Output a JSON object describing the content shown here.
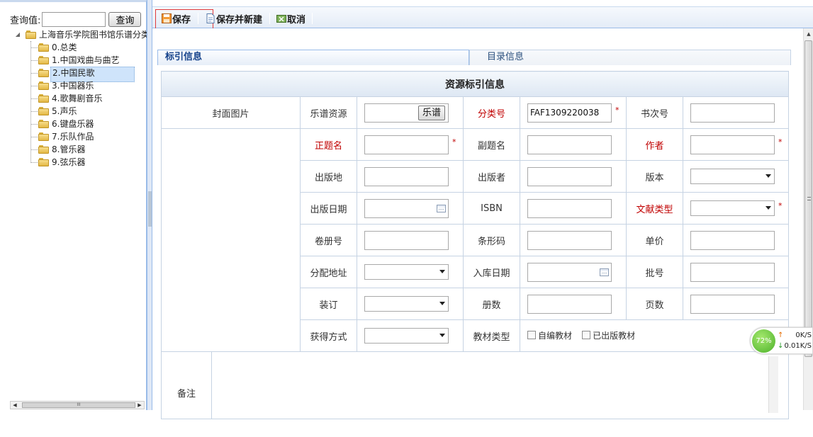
{
  "search": {
    "label": "查询值:",
    "value": "",
    "button": "查询"
  },
  "tree": {
    "root": "上海音乐学院图书馆乐谱分类",
    "items": [
      {
        "label": "0.总类"
      },
      {
        "label": "1.中国戏曲与曲艺"
      },
      {
        "label": "2.中国民歌",
        "selected": true
      },
      {
        "label": "3.中国器乐"
      },
      {
        "label": "4.歌舞剧音乐"
      },
      {
        "label": "5.声乐"
      },
      {
        "label": "6.键盘乐器"
      },
      {
        "label": "7.乐队作品"
      },
      {
        "label": "8.管乐器"
      },
      {
        "label": "9.弦乐器"
      }
    ]
  },
  "toolbar": {
    "save": "保存",
    "save_new": "保存并新建",
    "cancel": "取消"
  },
  "tabs": {
    "index": "标引信息",
    "catalog": "目录信息"
  },
  "form": {
    "header": "资源标引信息",
    "cover": "封面图片",
    "score_resource": "乐谱资源",
    "score_button": "乐谱",
    "class_no": {
      "label": "分类号",
      "value": "FAF1309220038"
    },
    "book_no": "书次号",
    "title": "正题名",
    "subtitle": "副题名",
    "author": "作者",
    "pub_place": "出版地",
    "publisher": "出版者",
    "edition": "版本",
    "pub_date": "出版日期",
    "isbn": "ISBN",
    "doc_type": "文献类型",
    "volume": "卷册号",
    "barcode": "条形码",
    "unit_price": "单价",
    "location": "分配地址",
    "in_date": "入库日期",
    "batch": "批号",
    "binding": "装订",
    "copies": "册数",
    "pages": "页数",
    "acquire": "获得方式",
    "textbook_type": "教材类型",
    "self_textbook": "自编教材",
    "published_textbook": "已出版教材",
    "remark": "备注"
  },
  "net_widget": {
    "percent": "72%",
    "up": "0K/S",
    "down": "0.01K/S"
  }
}
